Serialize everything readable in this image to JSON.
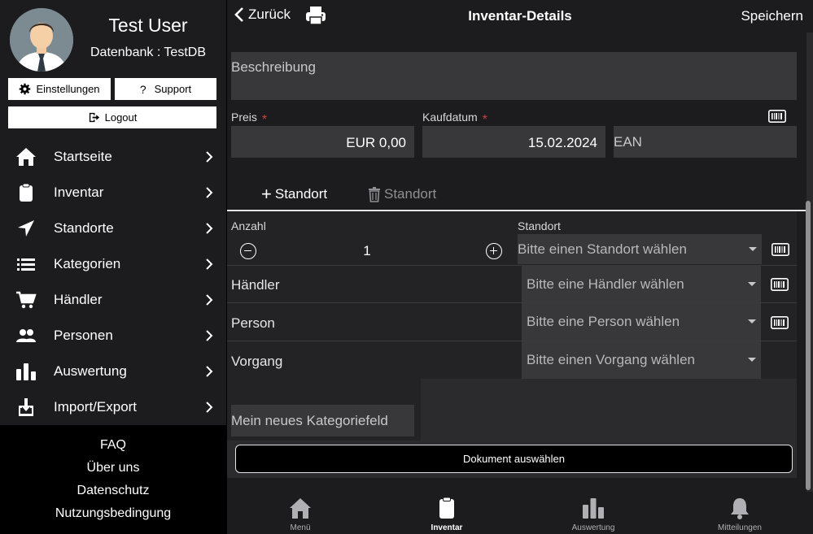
{
  "sidebar": {
    "user_name": "Test User",
    "database_label": "Datenbank : TestDB",
    "settings_label": "Einstellungen",
    "support_label": "Support",
    "logout_label": "Logout",
    "nav_items": [
      {
        "label": "Startseite",
        "icon": "home-icon"
      },
      {
        "label": "Inventar",
        "icon": "clipboard-icon"
      },
      {
        "label": "Standorte",
        "icon": "location-arrow-icon"
      },
      {
        "label": "Kategorien",
        "icon": "list-icon"
      },
      {
        "label": "Händler",
        "icon": "cart-icon"
      },
      {
        "label": "Personen",
        "icon": "people-icon"
      },
      {
        "label": "Auswertung",
        "icon": "chart-icon"
      },
      {
        "label": "Import/Export",
        "icon": "download-icon"
      }
    ],
    "footer_links": [
      "FAQ",
      "Über uns",
      "Datenschutz",
      "Nutzungsbedingung"
    ]
  },
  "header": {
    "back_label": "Zurück",
    "title": "Inventar-Details",
    "save_label": "Speichern"
  },
  "form": {
    "description_placeholder": "Beschreibung",
    "price_label": "Preis",
    "price_value": "EUR 0,00",
    "purchase_date_label": "Kaufdatum",
    "purchase_date_value": "15.02.2024",
    "required_mark": "*",
    "ean_placeholder": "EAN",
    "add_location_label": "Standort",
    "delete_location_label": "Standort",
    "quantity_label": "Anzahl",
    "quantity_value": "1",
    "location_label": "Standort",
    "location_placeholder": "Bitte einen Standort wählen",
    "dealer_label": "Händler",
    "dealer_placeholder": "Bitte eine Händler wählen",
    "person_label": "Person",
    "person_placeholder": "Bitte eine Person wählen",
    "process_label": "Vorgang",
    "process_placeholder": "Bitte einen Vorgang wählen",
    "custom_field_placeholder": "Mein neues Kategoriefeld",
    "document_button_label": "Dokument auswählen"
  },
  "tabbar": {
    "items": [
      {
        "label": "Menü",
        "icon": "home-icon"
      },
      {
        "label": "Inventar",
        "icon": "clipboard-icon",
        "active": true
      },
      {
        "label": "Auswertung",
        "icon": "chart-icon"
      },
      {
        "label": "Mitteilungen",
        "icon": "bell-icon"
      }
    ]
  },
  "colors": {
    "accent_required": "#c9433f",
    "field_bg": "#38383a",
    "panel_bg": "#1c1c1e"
  }
}
